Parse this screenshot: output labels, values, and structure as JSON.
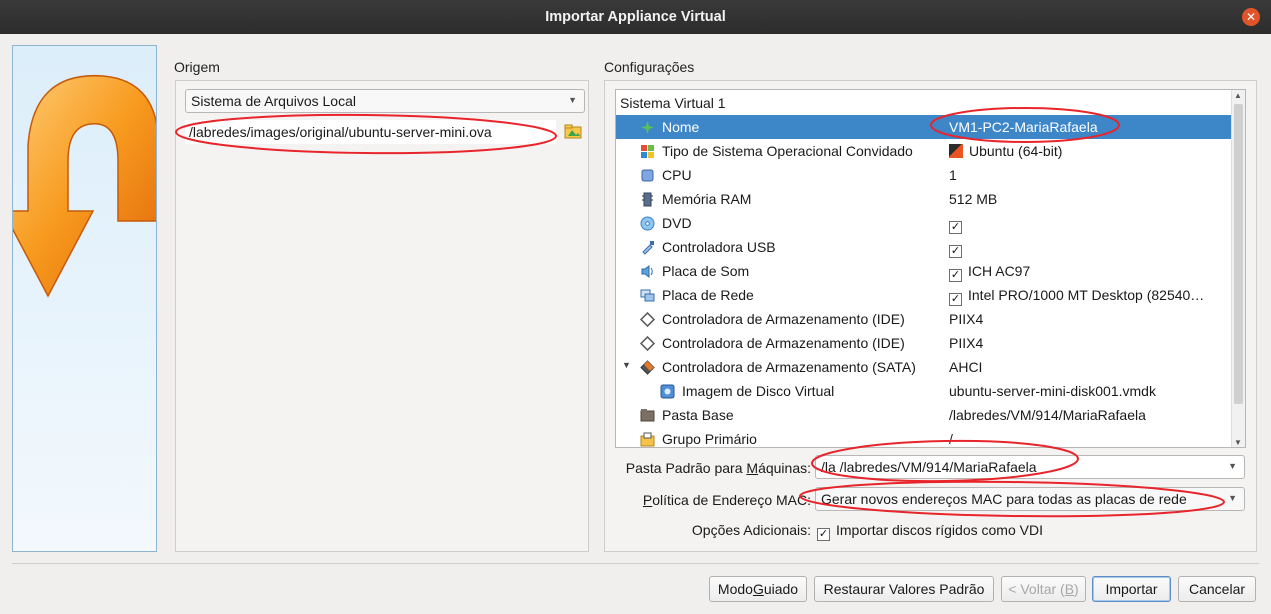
{
  "window": {
    "title": "Importar Appliance Virtual"
  },
  "source": {
    "section_label": "Origem",
    "type_value": "Sistema de Arquivos Local",
    "file_path": "/labredes/images/original/ubuntu-server-mini.ova"
  },
  "settings": {
    "section_label": "Configurações",
    "group_header": "Sistema Virtual 1",
    "rows": [
      {
        "name": "Nome",
        "value": "VM1-PC2-MariaRafaela",
        "checked": false
      },
      {
        "name": "Tipo de Sistema Operacional Convidado",
        "value": "Ubuntu (64-bit)",
        "checked": false
      },
      {
        "name": "CPU",
        "value": "1",
        "checked": false
      },
      {
        "name": "Memória RAM",
        "value": "512 MB",
        "checked": false
      },
      {
        "name": "DVD",
        "value": "",
        "checked": true
      },
      {
        "name": "Controladora USB",
        "value": "",
        "checked": true
      },
      {
        "name": "Placa de Som",
        "value": "ICH AC97",
        "checked": true
      },
      {
        "name": "Placa de Rede",
        "value": "Intel PRO/1000 MT Desktop (82540…",
        "checked": true
      },
      {
        "name": "Controladora de Armazenamento (IDE)",
        "value": "PIIX4",
        "checked": false
      },
      {
        "name": "Controladora de Armazenamento (IDE)",
        "value": "PIIX4",
        "checked": false
      },
      {
        "name": "Controladora de Armazenamento (SATA)",
        "value": "AHCI",
        "checked": false
      },
      {
        "name": "Imagem de Disco Virtual",
        "value": "ubuntu-server-mini-disk001.vmdk",
        "checked": false
      },
      {
        "name": "Pasta Base",
        "value": "/labredes/VM/914/MariaRafaela",
        "checked": false
      },
      {
        "name": "Grupo Primário",
        "value": "/",
        "checked": false
      }
    ],
    "machine_folder_label": "Pasta Padrão para Máquinas:",
    "machine_folder_value": "/la /labredes/VM/914/MariaRafaela",
    "mac_policy_label": "Política de Endereço MAC:",
    "mac_policy_value": "Gerar novos endereços MAC para todas as placas de rede",
    "options_label": "Opções Adicionais:",
    "import_vdi_label": "Importar discos rígidos como VDI",
    "import_vdi_checked": true
  },
  "buttons": {
    "guided": "Modo Guiado",
    "restore": "Restaurar Valores Padrão",
    "back": "< Voltar (B)",
    "import": "Importar",
    "cancel": "Cancelar"
  },
  "colors": {
    "selection": "#3d86c8",
    "annotation": "#e8252b",
    "titlebar": "#2c2c2c"
  }
}
